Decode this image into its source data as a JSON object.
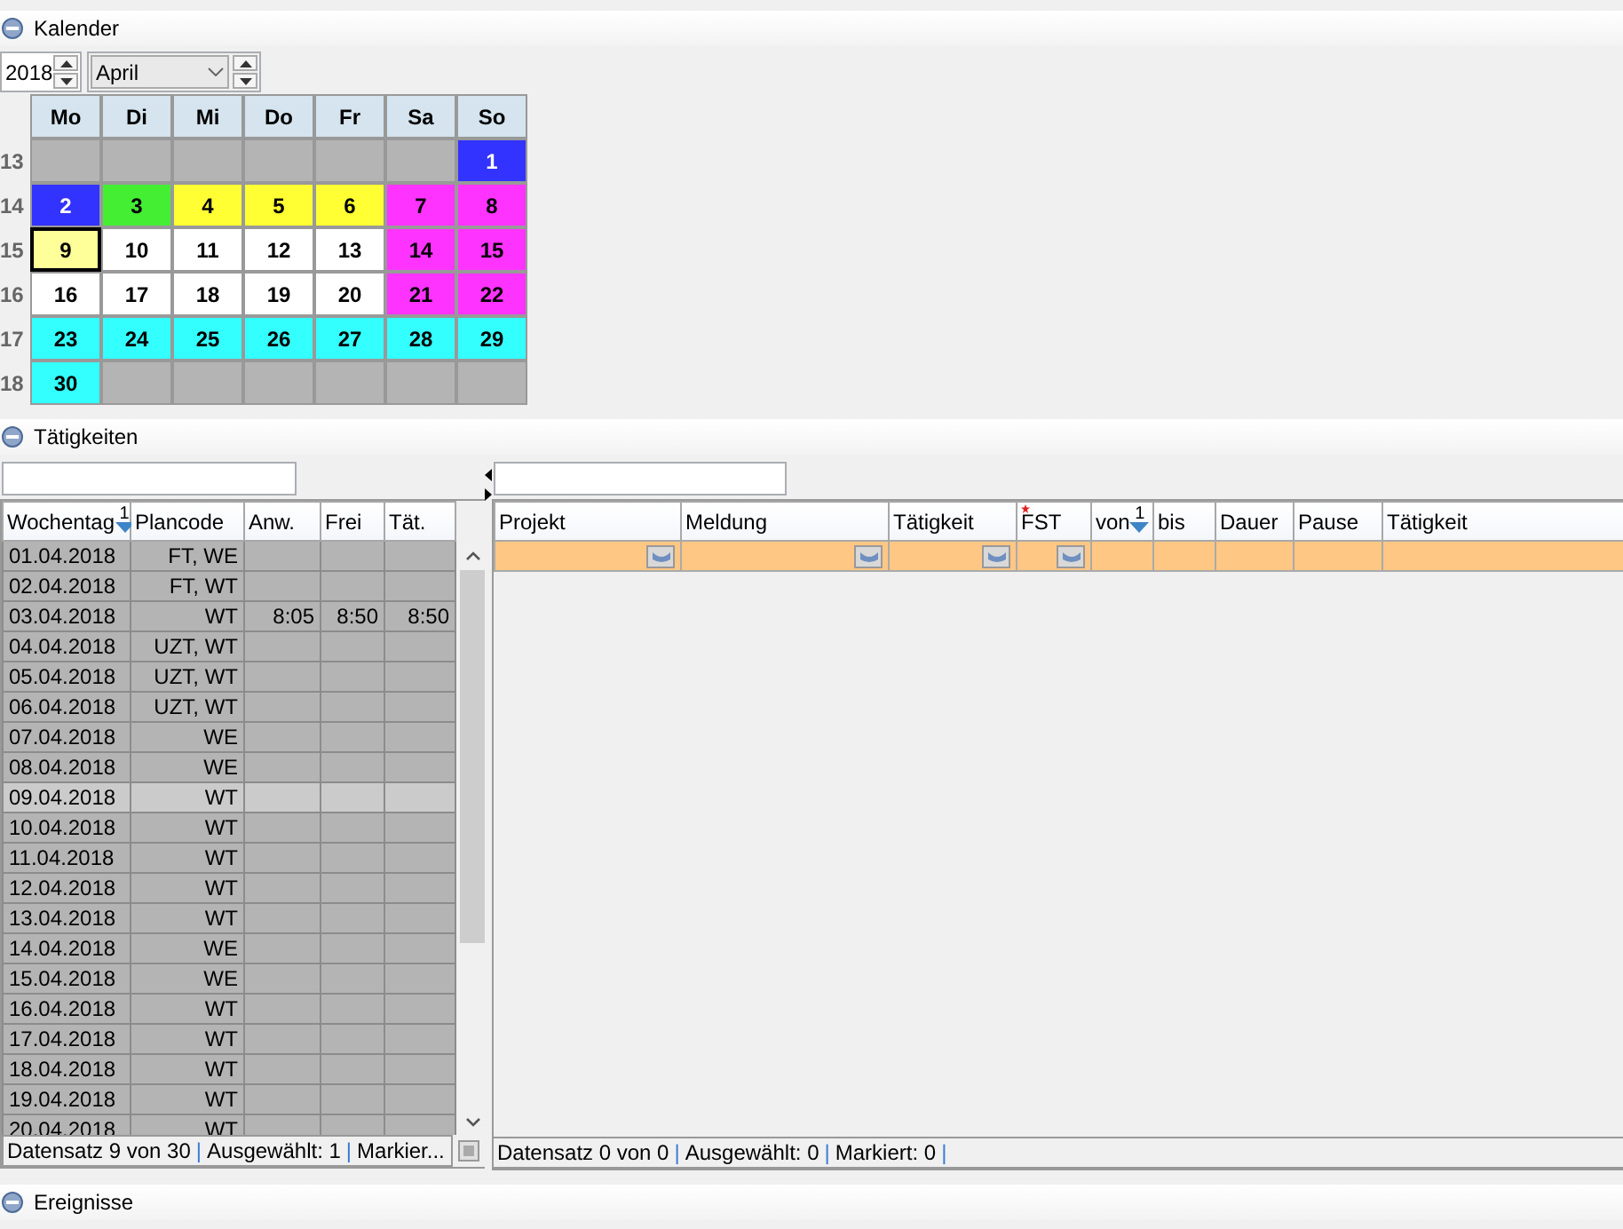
{
  "kalender": {
    "title": "Kalender",
    "expanded": true,
    "year": "2018",
    "month": "April",
    "weekdays": [
      "Mo",
      "Di",
      "Mi",
      "Do",
      "Fr",
      "Sa",
      "So"
    ],
    "weeks": [
      {
        "week": "13",
        "days": [
          {
            "kind": "empty"
          },
          {
            "kind": "empty"
          },
          {
            "kind": "empty"
          },
          {
            "kind": "empty"
          },
          {
            "kind": "empty"
          },
          {
            "kind": "empty"
          },
          {
            "kind": "day",
            "day": "1",
            "color": "#3333ff",
            "selected": false
          }
        ]
      },
      {
        "week": "14",
        "days": [
          {
            "kind": "day",
            "day": "2",
            "color": "#3333ff",
            "selected": false
          },
          {
            "kind": "day",
            "day": "3",
            "color": "#44ee33",
            "selected": false
          },
          {
            "kind": "day",
            "day": "4",
            "color": "#ffff33",
            "selected": false
          },
          {
            "kind": "day",
            "day": "5",
            "color": "#ffff33",
            "selected": false
          },
          {
            "kind": "day",
            "day": "6",
            "color": "#ffff33",
            "selected": false
          },
          {
            "kind": "day",
            "day": "7",
            "color": "#ff33ff",
            "selected": false
          },
          {
            "kind": "day",
            "day": "8",
            "color": "#ff33ff",
            "selected": false
          }
        ]
      },
      {
        "week": "15",
        "days": [
          {
            "kind": "day",
            "day": "9",
            "color": "#ffff99",
            "selected": true
          },
          {
            "kind": "day",
            "day": "10",
            "color": "#ffffff",
            "selected": false
          },
          {
            "kind": "day",
            "day": "11",
            "color": "#ffffff",
            "selected": false
          },
          {
            "kind": "day",
            "day": "12",
            "color": "#ffffff",
            "selected": false
          },
          {
            "kind": "day",
            "day": "13",
            "color": "#ffffff",
            "selected": false
          },
          {
            "kind": "day",
            "day": "14",
            "color": "#ff33ff",
            "selected": false
          },
          {
            "kind": "day",
            "day": "15",
            "color": "#ff33ff",
            "selected": false
          }
        ]
      },
      {
        "week": "16",
        "days": [
          {
            "kind": "day",
            "day": "16",
            "color": "#ffffff",
            "selected": false
          },
          {
            "kind": "day",
            "day": "17",
            "color": "#ffffff",
            "selected": false
          },
          {
            "kind": "day",
            "day": "18",
            "color": "#ffffff",
            "selected": false
          },
          {
            "kind": "day",
            "day": "19",
            "color": "#ffffff",
            "selected": false
          },
          {
            "kind": "day",
            "day": "20",
            "color": "#ffffff",
            "selected": false
          },
          {
            "kind": "day",
            "day": "21",
            "color": "#ff33ff",
            "selected": false
          },
          {
            "kind": "day",
            "day": "22",
            "color": "#ff33ff",
            "selected": false
          }
        ]
      },
      {
        "week": "17",
        "days": [
          {
            "kind": "day",
            "day": "23",
            "color": "#33ffff",
            "selected": false
          },
          {
            "kind": "day",
            "day": "24",
            "color": "#33ffff",
            "selected": false
          },
          {
            "kind": "day",
            "day": "25",
            "color": "#33ffff",
            "selected": false
          },
          {
            "kind": "day",
            "day": "26",
            "color": "#33ffff",
            "selected": false
          },
          {
            "kind": "day",
            "day": "27",
            "color": "#33ffff",
            "selected": false
          },
          {
            "kind": "day",
            "day": "28",
            "color": "#33ffff",
            "selected": false
          },
          {
            "kind": "day",
            "day": "29",
            "color": "#33ffff",
            "selected": false
          }
        ]
      },
      {
        "week": "18",
        "days": [
          {
            "kind": "day",
            "day": "30",
            "color": "#33ffff",
            "selected": false
          },
          {
            "kind": "empty"
          },
          {
            "kind": "empty"
          },
          {
            "kind": "empty"
          },
          {
            "kind": "empty"
          },
          {
            "kind": "empty"
          },
          {
            "kind": "empty"
          }
        ]
      }
    ]
  },
  "taetigkeiten": {
    "title": "Tätigkeiten",
    "expanded": true,
    "left_table": {
      "columns": [
        {
          "label": "Wochentag",
          "sort": "1"
        },
        {
          "label": "Plancode"
        },
        {
          "label": "Anw."
        },
        {
          "label": "Frei"
        },
        {
          "label": "Tät."
        }
      ],
      "rows": [
        {
          "wochentag": "01.04.2018",
          "plancode": "FT, WE",
          "selected": false
        },
        {
          "wochentag": "02.04.2018",
          "plancode": "FT, WT",
          "selected": false
        },
        {
          "wochentag": "03.04.2018",
          "plancode": "WT",
          "anw": "8:05",
          "frei": "8:50",
          "taet": "8:50",
          "selected": false
        },
        {
          "wochentag": "04.04.2018",
          "plancode": "UZT, WT",
          "selected": false
        },
        {
          "wochentag": "05.04.2018",
          "plancode": "UZT, WT",
          "selected": false
        },
        {
          "wochentag": "06.04.2018",
          "plancode": "UZT, WT",
          "selected": false
        },
        {
          "wochentag": "07.04.2018",
          "plancode": "WE",
          "selected": false
        },
        {
          "wochentag": "08.04.2018",
          "plancode": "WE",
          "selected": false
        },
        {
          "wochentag": "09.04.2018",
          "plancode": "WT",
          "selected": true
        },
        {
          "wochentag": "10.04.2018",
          "plancode": "WT",
          "selected": false
        },
        {
          "wochentag": "11.04.2018",
          "plancode": "WT",
          "selected": false
        },
        {
          "wochentag": "12.04.2018",
          "plancode": "WT",
          "selected": false
        },
        {
          "wochentag": "13.04.2018",
          "plancode": "WT",
          "selected": false
        },
        {
          "wochentag": "14.04.2018",
          "plancode": "WE",
          "selected": false
        },
        {
          "wochentag": "15.04.2018",
          "plancode": "WE",
          "selected": false
        },
        {
          "wochentag": "16.04.2018",
          "plancode": "WT",
          "selected": false
        },
        {
          "wochentag": "17.04.2018",
          "plancode": "WT",
          "selected": false
        },
        {
          "wochentag": "18.04.2018",
          "plancode": "WT",
          "selected": false
        },
        {
          "wochentag": "19.04.2018",
          "plancode": "WT",
          "selected": false
        },
        {
          "wochentag": "20.04.2018",
          "plancode": "WT",
          "selected": false
        }
      ],
      "status": {
        "parts": [
          "Datensatz 9 von 30",
          "Ausgewählt: 1",
          "Markier..."
        ],
        "separator": "|"
      }
    },
    "right_table": {
      "columns": [
        {
          "label": "Projekt",
          "dropdown": true
        },
        {
          "label": "Meldung",
          "dropdown": true
        },
        {
          "label": "Tätigkeit",
          "dropdown": true
        },
        {
          "label": "FST",
          "dropdown": true,
          "required": true
        },
        {
          "label": "von",
          "sort": "1"
        },
        {
          "label": "bis"
        },
        {
          "label": "Dauer"
        },
        {
          "label": "Pause"
        },
        {
          "label": "Tätigkeit"
        }
      ],
      "status": {
        "parts": [
          "Datensatz 0 von 0",
          "Ausgewählt: 0",
          "Markiert: 0"
        ],
        "separator": "|",
        "trailing_separator": true
      }
    }
  },
  "ereignisse": {
    "title": "Ereignisse",
    "expanded": true
  }
}
